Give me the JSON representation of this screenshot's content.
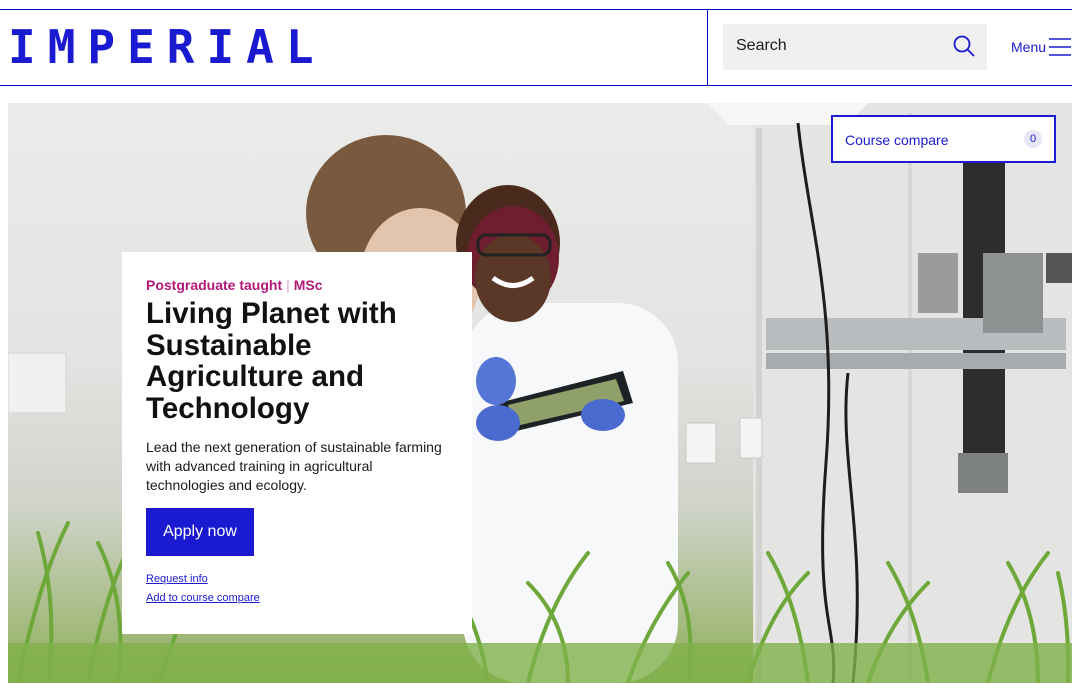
{
  "header": {
    "logo_text": "IMPERIAL",
    "search_placeholder": "Search",
    "menu_label": "Menu"
  },
  "course_compare": {
    "label": "Course compare",
    "count": "0"
  },
  "hero_card": {
    "level": "Postgraduate taught",
    "separator": "|",
    "qualification": "MSc",
    "title": "Living Planet with Sustainable Agriculture and Technology",
    "description": "Lead the next generation of sustainable farming with advanced training in agricultural technologies and ecology.",
    "apply_label": "Apply now",
    "request_info_label": "Request info",
    "add_compare_label": "Add to course compare"
  },
  "colors": {
    "brand_blue": "#1a1ad1",
    "accent_magenta": "#b31a78"
  }
}
